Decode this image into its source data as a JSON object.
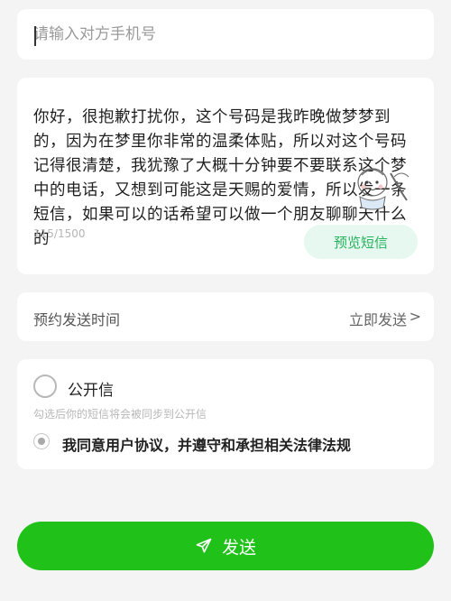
{
  "phone": {
    "placeholder": "请输入对方手机号",
    "value": ""
  },
  "message": {
    "text": "你好，很抱歉打扰你，这个号码是我昨晚做梦梦到的，因为在梦里你非常的温柔体贴，所以对这个号码记得很清楚，我犹豫了大概十分钟要不要联系这个梦中的电话，又想到可能这是天赐的爱情，所以发一条短信，如果可以的话希望可以做一个朋友聊聊天什么的",
    "char_count": "115/1500",
    "preview_label": "预览短信",
    "sticker_icon": "cartoon-sticker-icon"
  },
  "schedule": {
    "label": "预约发送时间",
    "value": "立即发送",
    "chevron": ">"
  },
  "options": {
    "public_label": "公开信",
    "public_hint": "勾选后你的短信将会被同步到公开信",
    "public_checked": false,
    "agree_label": "我同意用户协议，并遵守和承担相关法律法规",
    "agree_checked": true
  },
  "send": {
    "label": "发送",
    "icon": "paper-plane-icon",
    "color": "#20c21a"
  },
  "colors": {
    "accent_green": "#25b35e",
    "preview_bg": "#e6f8ef",
    "page_bg": "#f4f4f4"
  }
}
